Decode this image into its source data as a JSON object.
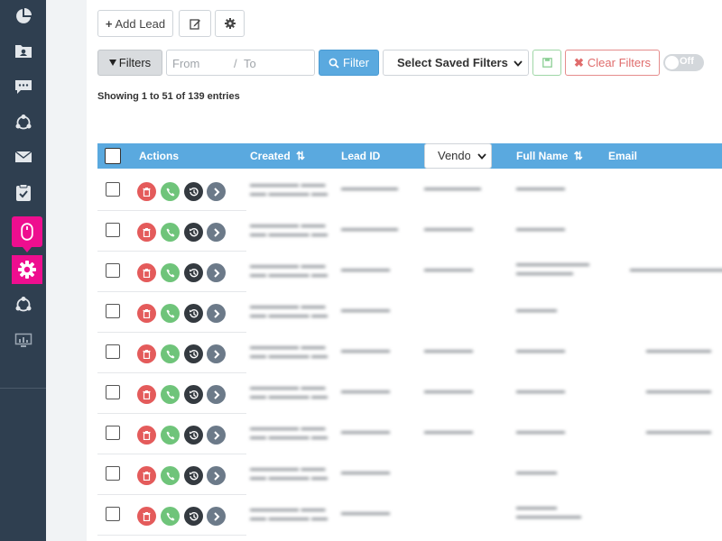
{
  "sidebar": {
    "icons": [
      "pie-chart-icon",
      "contacts-folder-icon",
      "chat-icon",
      "share-network-icon",
      "envelope-icon",
      "checklist-icon",
      "mouse-icon",
      "gear-icon",
      "share-network-icon",
      "monitor-chart-icon"
    ],
    "active_color": "#ee0e8f"
  },
  "toolbar": {
    "add_lead_label": "Add Lead",
    "edit_icon": "edit-icon",
    "settings_icon": "gear-icon"
  },
  "filters": {
    "filters_label": "Filters",
    "from_placeholder": "From",
    "separator": "/",
    "to_placeholder": "To",
    "filter_button": "Filter",
    "saved_filters_label": "Select Saved Filters",
    "clear_label": "Clear Filters",
    "toggle_label": "Off"
  },
  "info": {
    "showing_text": "Showing 1 to 51 of 139 entries"
  },
  "table": {
    "columns": {
      "actions": "Actions",
      "created": "Created",
      "lead_id": "Lead ID",
      "vendor_select": "Vendor",
      "full_name": "Full Name",
      "email": "Email"
    },
    "sort_icon": "sort-icon",
    "row_count_visible": 9,
    "header_color": "#5aa9df"
  },
  "colors": {
    "delete": "#e45b5b",
    "call": "#6fc47a",
    "history": "#343a40",
    "next": "#6c7a89",
    "filter_button": "#5aa9df",
    "clear": "#e06c6c",
    "save": "#6fc47a"
  }
}
